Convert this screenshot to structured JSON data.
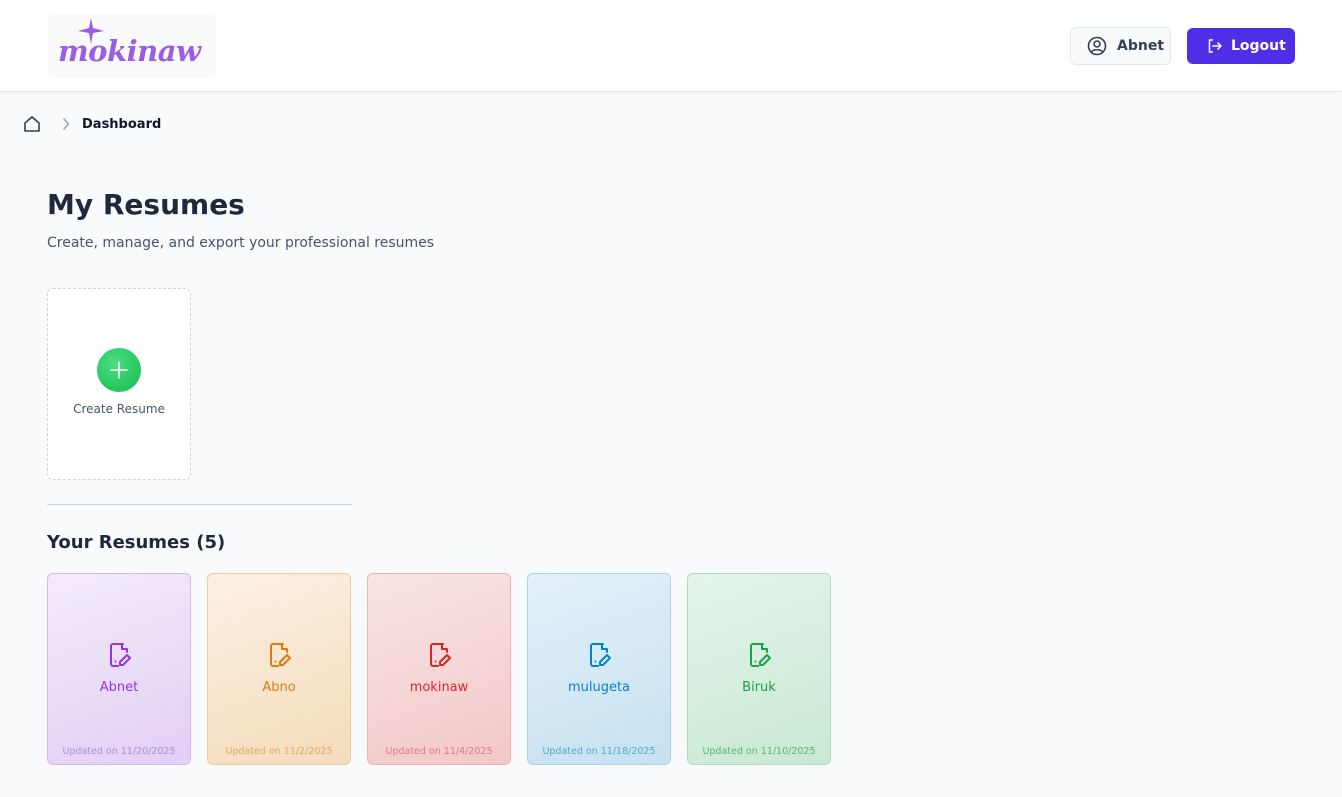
{
  "header": {
    "logo_text": "mokinaw",
    "user_label": "Abnet",
    "logout_label": "Logout"
  },
  "breadcrumb": {
    "current": "Dashboard"
  },
  "main": {
    "title": "My Resumes",
    "subtitle": "Create, manage, and export your professional resumes",
    "create_label": "Create Resume",
    "section_title": "Your Resumes (5)"
  },
  "resumes": [
    {
      "name": "Abnet",
      "updated": "Updated on 11/20/2025",
      "color": "#9333ea"
    },
    {
      "name": "Abno",
      "updated": "Updated on 11/2/2025",
      "color": "#e07a0c"
    },
    {
      "name": "mokinaw",
      "updated": "Updated on 11/4/2025",
      "color": "#dc2626"
    },
    {
      "name": "mulugeta",
      "updated": "Updated on 11/18/2025",
      "color": "#0284c7"
    },
    {
      "name": "Biruk",
      "updated": "Updated on 11/10/2025",
      "color": "#16a34a"
    }
  ],
  "colors": {
    "brand": "#9b5de5",
    "primary_button": "#4f2ee8",
    "create_accent": "#22c55e"
  }
}
